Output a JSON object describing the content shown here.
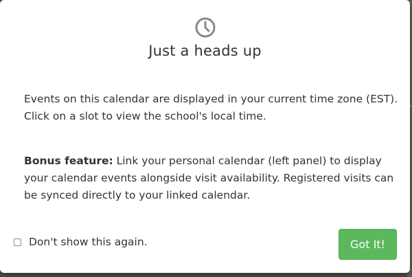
{
  "modal": {
    "icon": "clock-icon",
    "title": "Just a heads up",
    "paragraph_1": "Events on this calendar are displayed in your current time zone (EST). Click on a slot to view the school's local time.",
    "paragraph_2_label": "Bonus feature:",
    "paragraph_2_text": " Link your personal calendar (left panel) to display your calendar events alongside visit availability. Registered visits can be synced directly to your linked calendar.",
    "checkbox_label": "Don't show this again.",
    "checkbox_checked": false,
    "button_label": "Got It!"
  },
  "colors": {
    "button_background": "#5cb85c",
    "text": "#333333",
    "icon": "#888888"
  }
}
